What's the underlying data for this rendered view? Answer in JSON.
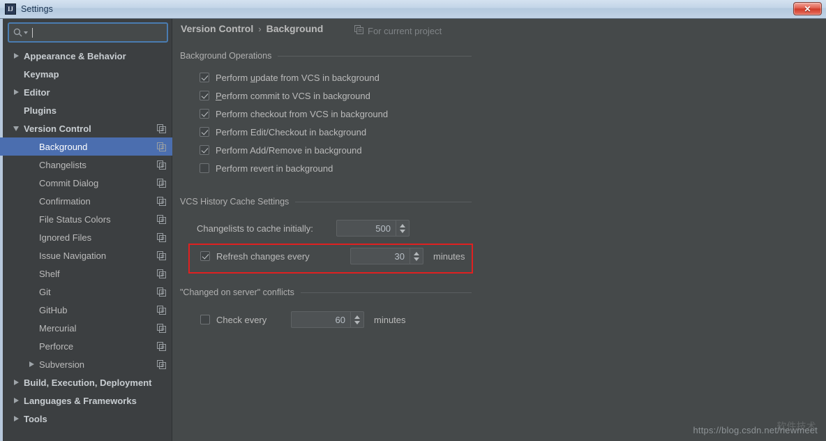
{
  "window": {
    "title": "Settings",
    "app_icon": "IJ",
    "close_label": "✕"
  },
  "sidebar": {
    "search": {
      "value": "",
      "placeholder": "",
      "icon": "search-icon"
    },
    "items": [
      {
        "label": "Appearance & Behavior",
        "level": 0,
        "bold": true,
        "twisty": "collapsed",
        "copy": false,
        "selected": false
      },
      {
        "label": "Keymap",
        "level": 0,
        "bold": true,
        "twisty": "none",
        "copy": false,
        "selected": false
      },
      {
        "label": "Editor",
        "level": 0,
        "bold": true,
        "twisty": "collapsed",
        "copy": false,
        "selected": false
      },
      {
        "label": "Plugins",
        "level": 0,
        "bold": true,
        "twisty": "none",
        "copy": false,
        "selected": false
      },
      {
        "label": "Version Control",
        "level": 0,
        "bold": true,
        "twisty": "expanded",
        "copy": true,
        "selected": false
      },
      {
        "label": "Background",
        "level": 1,
        "bold": false,
        "twisty": "none",
        "copy": true,
        "selected": true
      },
      {
        "label": "Changelists",
        "level": 1,
        "bold": false,
        "twisty": "none",
        "copy": true,
        "selected": false
      },
      {
        "label": "Commit Dialog",
        "level": 1,
        "bold": false,
        "twisty": "none",
        "copy": true,
        "selected": false
      },
      {
        "label": "Confirmation",
        "level": 1,
        "bold": false,
        "twisty": "none",
        "copy": true,
        "selected": false
      },
      {
        "label": "File Status Colors",
        "level": 1,
        "bold": false,
        "twisty": "none",
        "copy": true,
        "selected": false
      },
      {
        "label": "Ignored Files",
        "level": 1,
        "bold": false,
        "twisty": "none",
        "copy": true,
        "selected": false
      },
      {
        "label": "Issue Navigation",
        "level": 1,
        "bold": false,
        "twisty": "none",
        "copy": true,
        "selected": false
      },
      {
        "label": "Shelf",
        "level": 1,
        "bold": false,
        "twisty": "none",
        "copy": true,
        "selected": false
      },
      {
        "label": "Git",
        "level": 1,
        "bold": false,
        "twisty": "none",
        "copy": true,
        "selected": false
      },
      {
        "label": "GitHub",
        "level": 1,
        "bold": false,
        "twisty": "none",
        "copy": true,
        "selected": false
      },
      {
        "label": "Mercurial",
        "level": 1,
        "bold": false,
        "twisty": "none",
        "copy": true,
        "selected": false
      },
      {
        "label": "Perforce",
        "level": 1,
        "bold": false,
        "twisty": "none",
        "copy": true,
        "selected": false
      },
      {
        "label": "Subversion",
        "level": 1,
        "bold": false,
        "twisty": "collapsed",
        "copy": true,
        "selected": false
      },
      {
        "label": "Build, Execution, Deployment",
        "level": 0,
        "bold": true,
        "twisty": "collapsed",
        "copy": false,
        "selected": false
      },
      {
        "label": "Languages & Frameworks",
        "level": 0,
        "bold": true,
        "twisty": "collapsed",
        "copy": false,
        "selected": false
      },
      {
        "label": "Tools",
        "level": 0,
        "bold": true,
        "twisty": "collapsed",
        "copy": false,
        "selected": false
      }
    ]
  },
  "content": {
    "breadcrumb": {
      "parent": "Version Control",
      "separator": "›",
      "current": "Background"
    },
    "for_current_project": "For current project",
    "sections": {
      "background_operations": "Background Operations",
      "vcs_history_cache": "VCS History Cache Settings",
      "changed_on_server": "\"Changed on server\" conflicts"
    },
    "checkboxes": [
      {
        "pre": "Perform ",
        "mnemonic": "u",
        "post": "pdate from VCS in background",
        "checked": true
      },
      {
        "pre": "",
        "mnemonic": "P",
        "post": "erform commit to VCS in background",
        "checked": true
      },
      {
        "pre": "Perform checkout from VCS in background",
        "mnemonic": "",
        "post": "",
        "checked": true
      },
      {
        "pre": "Perform Edit/Checkout in background",
        "mnemonic": "",
        "post": "",
        "checked": true
      },
      {
        "pre": "Perform Add/Remove in background",
        "mnemonic": "",
        "post": "",
        "checked": true
      },
      {
        "pre": "Perform revert in background",
        "mnemonic": "",
        "post": "",
        "checked": false
      }
    ],
    "cache_initially": {
      "label": "Changelists to cache initially:",
      "value": "500"
    },
    "refresh_changes": {
      "label": "Refresh changes every",
      "value": "30",
      "unit": "minutes",
      "checked": true
    },
    "check_every": {
      "label": "Check every",
      "value": "60",
      "unit": "minutes",
      "checked": false
    }
  },
  "watermark": {
    "url": "https://blog.csdn.net/newmeet",
    "overlay": "软件技术"
  },
  "colors": {
    "selection": "#4b6eaf",
    "sidebar_bg": "#3c3f41",
    "content_bg": "#45494a",
    "annotation": "#e02020",
    "focus_border": "#4a7cb1"
  }
}
